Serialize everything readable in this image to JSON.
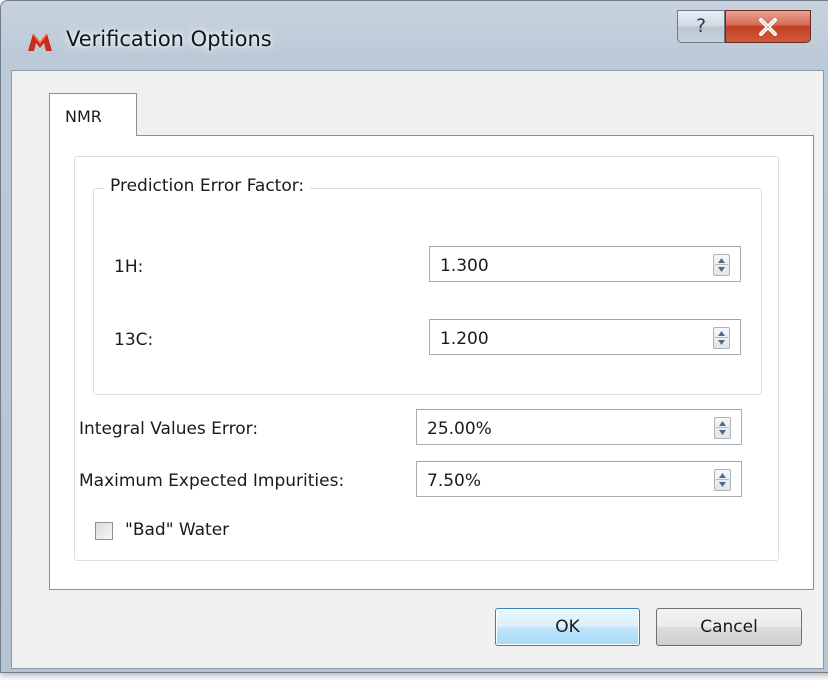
{
  "window": {
    "title": "Verification Options",
    "help_glyph": "?",
    "close_glyph": "X",
    "app_icon": "mnova-logo-icon",
    "accent_close": "#c23f26",
    "logo_color": "#cc2a1a"
  },
  "tabs": [
    {
      "label": "NMR",
      "selected": true
    }
  ],
  "prediction_group": {
    "title": "Prediction Error Factor:",
    "fields": [
      {
        "label": "1H:",
        "value": "1.300"
      },
      {
        "label": "13C:",
        "value": "1.200"
      }
    ]
  },
  "integral_error": {
    "label": "Integral Values Error:",
    "value": "25.00%"
  },
  "max_impurities": {
    "label": "Maximum Expected Impurities:",
    "value": "7.50%"
  },
  "bad_water": {
    "label": "\"Bad\" Water",
    "checked": false
  },
  "buttons": {
    "ok": "OK",
    "cancel": "Cancel"
  }
}
